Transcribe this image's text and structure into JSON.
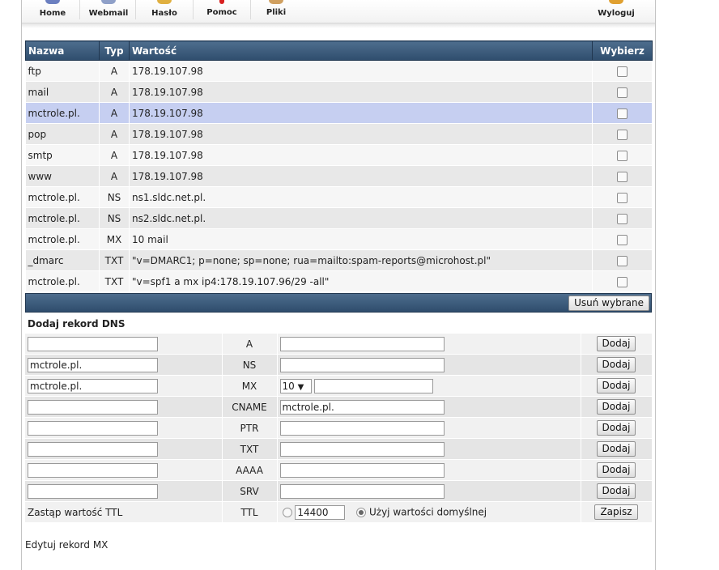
{
  "nav": {
    "items": [
      {
        "label": "Home",
        "icon": "home-icon",
        "color": "#6b7fc0"
      },
      {
        "label": "Webmail",
        "icon": "webmail-icon",
        "color": "#8fa0c8"
      },
      {
        "label": "Hasło",
        "icon": "password-icon",
        "color": "#e0b040"
      },
      {
        "label": "Pomoc",
        "icon": "help-icon",
        "color": "#d82020"
      },
      {
        "label": "Pliki",
        "icon": "files-icon",
        "color": "#d0a060"
      }
    ],
    "logout": {
      "label": "Wyloguj",
      "icon": "logout-icon",
      "color": "#e0a030"
    }
  },
  "records": {
    "headers": {
      "name": "Nazwa",
      "type": "Typ",
      "value": "Wartość",
      "select": "Wybierz"
    },
    "rows": [
      {
        "name": "ftp",
        "type": "A",
        "value": "178.19.107.98"
      },
      {
        "name": "mail",
        "type": "A",
        "value": "178.19.107.98"
      },
      {
        "name": "mctrole.pl.",
        "type": "A",
        "value": "178.19.107.98"
      },
      {
        "name": "pop",
        "type": "A",
        "value": "178.19.107.98"
      },
      {
        "name": "smtp",
        "type": "A",
        "value": "178.19.107.98"
      },
      {
        "name": "www",
        "type": "A",
        "value": "178.19.107.98"
      },
      {
        "name": "mctrole.pl.",
        "type": "NS",
        "value": "ns1.sldc.net.pl."
      },
      {
        "name": "mctrole.pl.",
        "type": "NS",
        "value": "ns2.sldc.net.pl."
      },
      {
        "name": "mctrole.pl.",
        "type": "MX",
        "value": "10 mail"
      },
      {
        "name": "_dmarc",
        "type": "TXT",
        "value": "\"v=DMARC1; p=none; sp=none; rua=mailto:spam-reports@microhost.pl\""
      },
      {
        "name": "mctrole.pl.",
        "type": "TXT",
        "value": "\"v=spf1 a mx ip4:178.19.107.96/29 -all\""
      }
    ],
    "delete_button": "Usuń wybrane"
  },
  "add": {
    "title": "Dodaj rekord DNS",
    "add_button": "Dodaj",
    "rows": {
      "a": {
        "name": "",
        "type": "A",
        "value": ""
      },
      "ns": {
        "name": "mctrole.pl.",
        "type": "NS",
        "value": ""
      },
      "mx": {
        "name": "mctrole.pl.",
        "type": "MX",
        "priority": "10",
        "value": ""
      },
      "cname": {
        "name": "",
        "type": "CNAME",
        "value": "mctrole.pl."
      },
      "ptr": {
        "name": "",
        "type": "PTR",
        "value": ""
      },
      "txt": {
        "name": "",
        "type": "TXT",
        "value": ""
      },
      "aaaa": {
        "name": "",
        "type": "AAAA",
        "value": ""
      },
      "srv": {
        "name": "",
        "type": "SRV",
        "value": ""
      }
    },
    "ttl": {
      "label": "Zastąp wartość TTL",
      "type": "TTL",
      "value": "14400",
      "default_label": "Użyj wartości domyślnej",
      "save_button": "Zapisz"
    }
  },
  "edit_mx_link": "Edytuj rekord MX",
  "colors": {
    "header_bg": "#3b5a7a",
    "selected_row": "#c6cff1"
  }
}
